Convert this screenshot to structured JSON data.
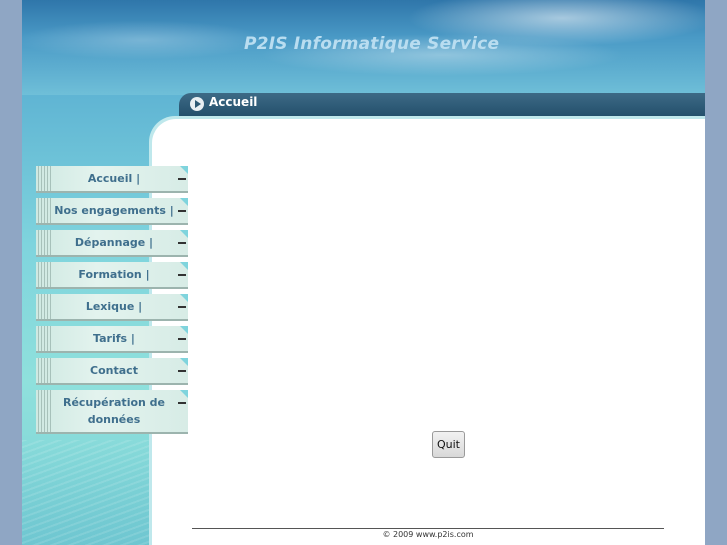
{
  "header": {
    "site_title": "P2IS Informatique Service"
  },
  "title_bar": {
    "heading": "Accueil",
    "icon": "play-arrow-icon"
  },
  "nav": {
    "items": [
      {
        "label": "Accueil |"
      },
      {
        "label": "Nos engagements |"
      },
      {
        "label": "Dépannage |"
      },
      {
        "label": "Formation |"
      },
      {
        "label": "Lexique |"
      },
      {
        "label": "Tarifs |"
      },
      {
        "label": "Contact"
      },
      {
        "label": "Récupération de données"
      }
    ]
  },
  "content": {
    "quit_label": "Quit"
  },
  "footer": {
    "copyright": "© 2009 www.p2is.com"
  },
  "colors": {
    "title_bar": "#24506c",
    "nav_text": "#3f6f8d",
    "background": "#7fd4dd"
  }
}
